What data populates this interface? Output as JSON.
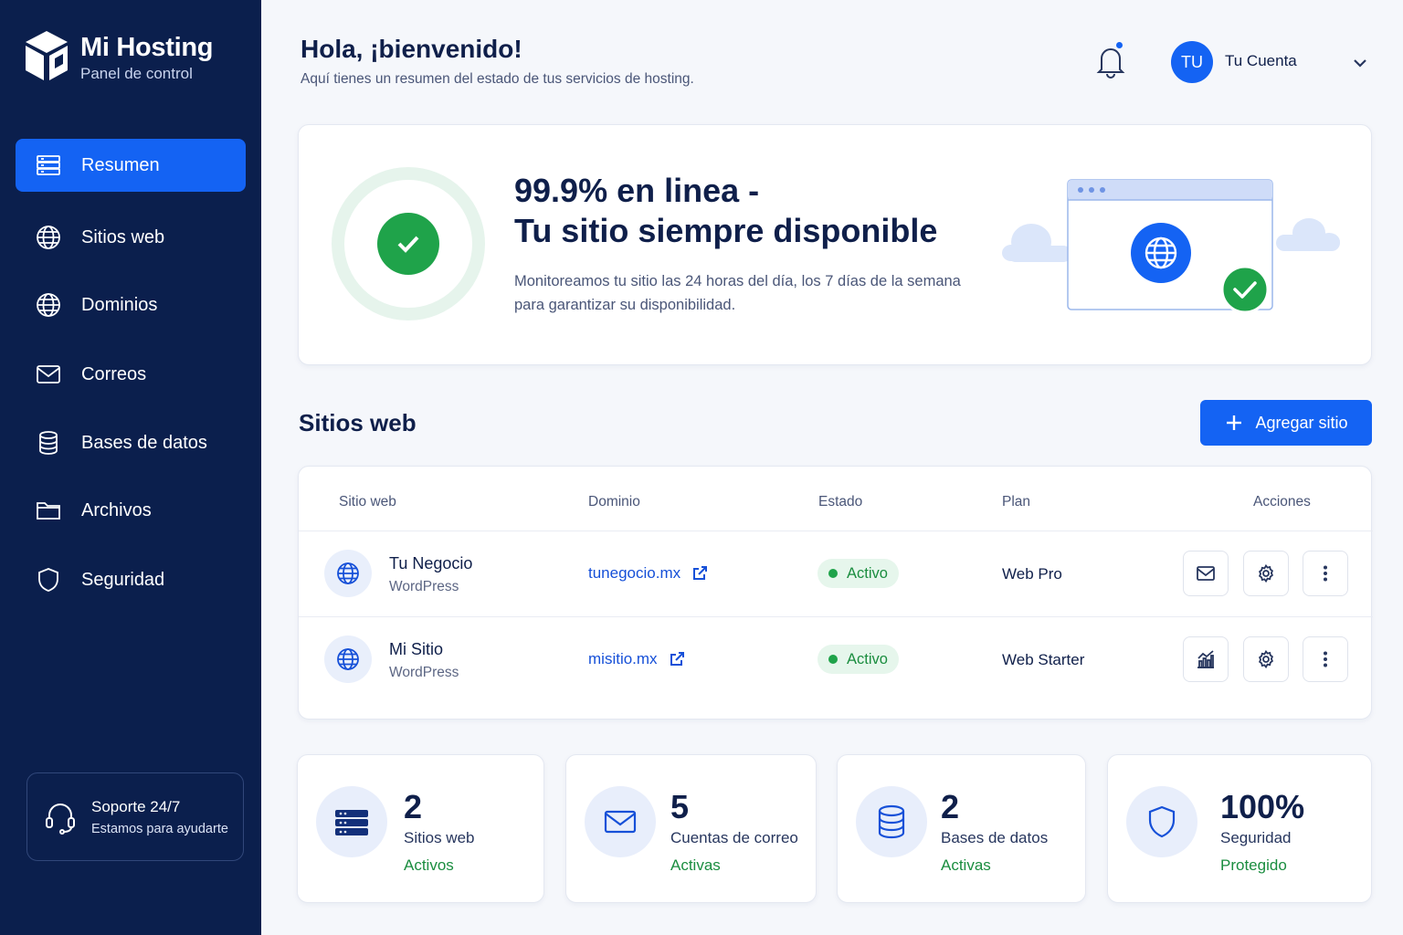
{
  "brand": {
    "title": "Mi Hosting",
    "subtitle": "Panel de control"
  },
  "nav": [
    {
      "label": "Resumen",
      "icon": "server-icon",
      "active": true
    },
    {
      "label": "Sitios web",
      "icon": "globe-icon"
    },
    {
      "label": "Dominios",
      "icon": "globe-icon"
    },
    {
      "label": "Correos",
      "icon": "mail-icon"
    },
    {
      "label": "Bases de datos",
      "icon": "database-icon"
    },
    {
      "label": "Archivos",
      "icon": "folder-icon"
    },
    {
      "label": "Seguridad",
      "icon": "shield-icon"
    }
  ],
  "support": {
    "title": "Soporte 24/7",
    "subtitle": "Estamos para ayudarte"
  },
  "header": {
    "greeting": "Hola, ¡bienvenido!",
    "subtitle": "Aquí tienes un resumen del estado de tus servicios de hosting.",
    "avatar_initials": "TU",
    "account_label": "Tu Cuenta"
  },
  "uptime": {
    "title_line1": "99.9% en linea -",
    "title_line2": "Tu sitio siempre disponible",
    "desc_line1": "Monitoreamos tu sitio las 24 horas del día, los 7 días de la semana",
    "desc_line2": "para garantizar su disponibilidad."
  },
  "sites": {
    "title": "Sitios web",
    "add_label": "Agregar sitio",
    "columns": [
      "Sitio web",
      "Dominio",
      "Estado",
      "Plan",
      "Acciones"
    ],
    "rows": [
      {
        "name": "Tu Negocio",
        "type": "WordPress",
        "domain": "tunegocio.mx",
        "status": "Activo",
        "plan": "Web Pro",
        "first_action_icon": "mail-icon"
      },
      {
        "name": "Mi Sitio",
        "type": "WordPress",
        "domain": "misitio.mx",
        "status": "Activo",
        "plan": "Web Starter",
        "first_action_icon": "analytics-icon"
      }
    ]
  },
  "stats": [
    {
      "value": "2",
      "label": "Sitios web",
      "state": "Activos",
      "icon": "server-icon"
    },
    {
      "value": "5",
      "label": "Cuentas de correo",
      "state": "Activas",
      "icon": "mail-icon"
    },
    {
      "value": "2",
      "label": "Bases de datos",
      "state": "Activas",
      "icon": "database-icon"
    },
    {
      "value": "100%",
      "label": "Seguridad",
      "state": "Protegido",
      "icon": "shield-icon"
    }
  ],
  "colors": {
    "sidebar": "#0b1f4d",
    "accent": "#1463f3",
    "success": "#1fa34a"
  }
}
